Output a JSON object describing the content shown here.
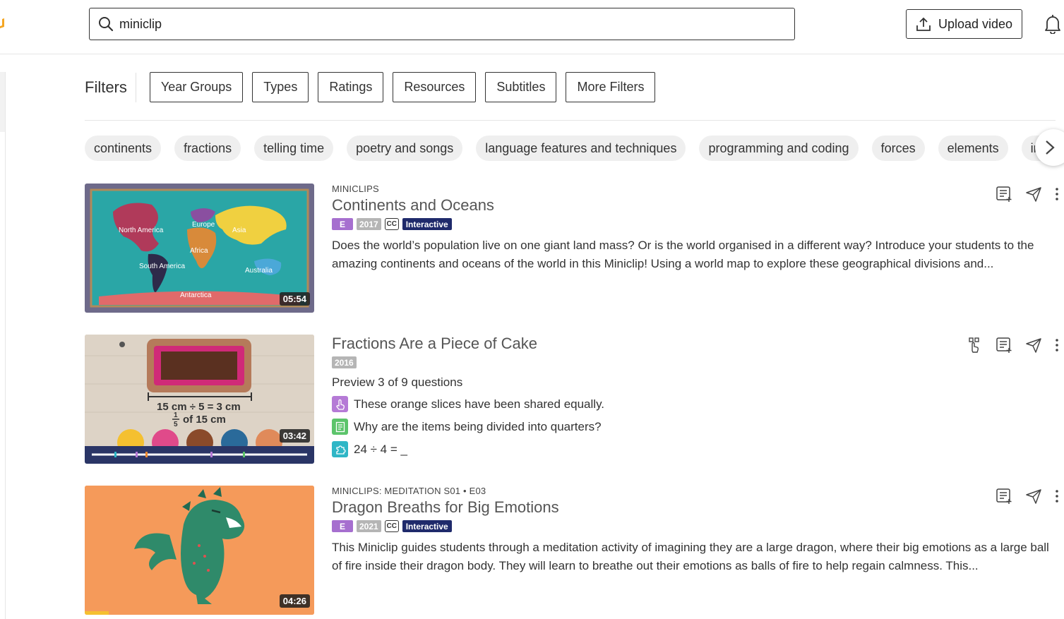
{
  "search": {
    "value": "miniclip"
  },
  "header": {
    "upload_label": "Upload video"
  },
  "filters": {
    "label": "Filters",
    "buttons": [
      "Year Groups",
      "Types",
      "Ratings",
      "Resources",
      "Subtitles",
      "More Filters"
    ]
  },
  "chips": [
    "continents",
    "fractions",
    "telling time",
    "poetry and songs",
    "language features and techniques",
    "programming and coding",
    "forces",
    "elements",
    "insects"
  ],
  "results": [
    {
      "series": "MINICLIPS",
      "title": "Continents and Oceans",
      "rating": "E",
      "year": "2017",
      "cc": "CC",
      "type": "Interactive",
      "description": "Does the world’s population live on one giant land mass? Or is the world organised in a different way? Introduce your students to the amazing continents and oceans of the world in this Miniclip! Using a world map to explore these geographical divisions and...",
      "duration": "05:54",
      "map_labels": [
        "North America",
        "Europe",
        "Asia",
        "Africa",
        "South America",
        "Australia",
        "Antarctica"
      ]
    },
    {
      "title": "Fractions Are a Piece of Cake",
      "year": "2016",
      "preview": "Preview 3 of 9 questions",
      "questions": [
        {
          "text": "These orange slices have been shared equally.",
          "icon": "touch-icon",
          "color": "#b57ad6"
        },
        {
          "text": "Why are the items being divided into quarters?",
          "icon": "notes-icon",
          "color": "#5cc46b"
        },
        {
          "text": "24 ÷ 4 = _",
          "icon": "puzzle-icon",
          "color": "#2fb6c6"
        }
      ],
      "duration": "03:42",
      "thumb_text": {
        "line1": "15 cm ÷ 5 = 3 cm",
        "frac_num": "1",
        "frac_den": "5",
        "line2": "of 15 cm"
      }
    },
    {
      "series": "MINICLIPS: MEDITATION S01 • E03",
      "title": "Dragon Breaths for Big Emotions",
      "rating": "E",
      "year": "2021",
      "cc": "CC",
      "type": "Interactive",
      "description": "This Miniclip guides students through a meditation activity of imagining they are a large dragon, where their big emotions as a large ball of fire inside their dragon body. They will learn to breathe out their emotions as balls of fire to help regain calmness. This...",
      "duration": "04:26"
    }
  ],
  "colors": {
    "accent": "#f5a623",
    "interactive": "#1f2a6b",
    "rating": "#a66fcf",
    "year": "#b5b5b5"
  }
}
